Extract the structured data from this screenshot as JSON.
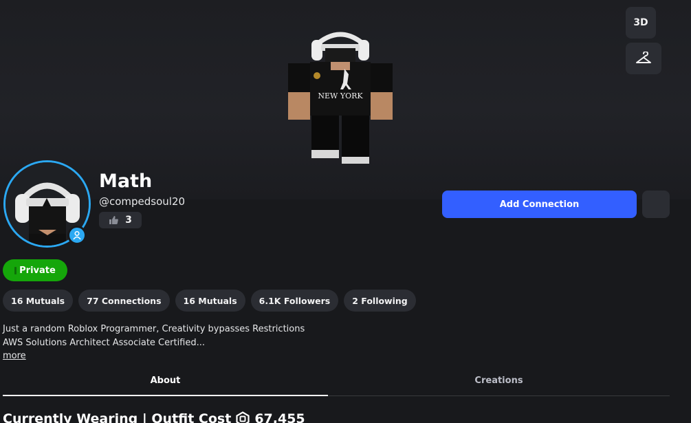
{
  "header": {
    "btn_3d_label": "3D",
    "btn_outfit_icon": "hanger-icon"
  },
  "profile": {
    "display_name": "Math",
    "username": "@compedsoul20",
    "likes_icon": "thumbs-up-icon",
    "likes": "3",
    "presence_icon": "user-icon",
    "presence_color": "#2ba8f2",
    "privacy_label": "Private",
    "privacy_color": "#15a60a",
    "avatar_shirt_text": "NEW YORK"
  },
  "actions": {
    "add_connection": "Add Connection",
    "add_connection_color": "#335fff"
  },
  "stats": [
    {
      "label": "16 Mutuals"
    },
    {
      "label": "77 Connections"
    },
    {
      "label": "16 Mutuals"
    },
    {
      "label": "6.1K Followers"
    },
    {
      "label": "2 Following"
    }
  ],
  "bio": {
    "line1": "Just a random Roblox Programmer, Creativity bypasses Restrictions",
    "line2": "AWS Solutions Architect Associate Certified...",
    "more": "more"
  },
  "tabs": [
    {
      "label": "About",
      "active": true
    },
    {
      "label": "Creations",
      "active": false
    }
  ],
  "section": {
    "title": "Currently Wearing | Outfit Cost",
    "currency_icon": "robux-icon",
    "cost": "67,455"
  }
}
